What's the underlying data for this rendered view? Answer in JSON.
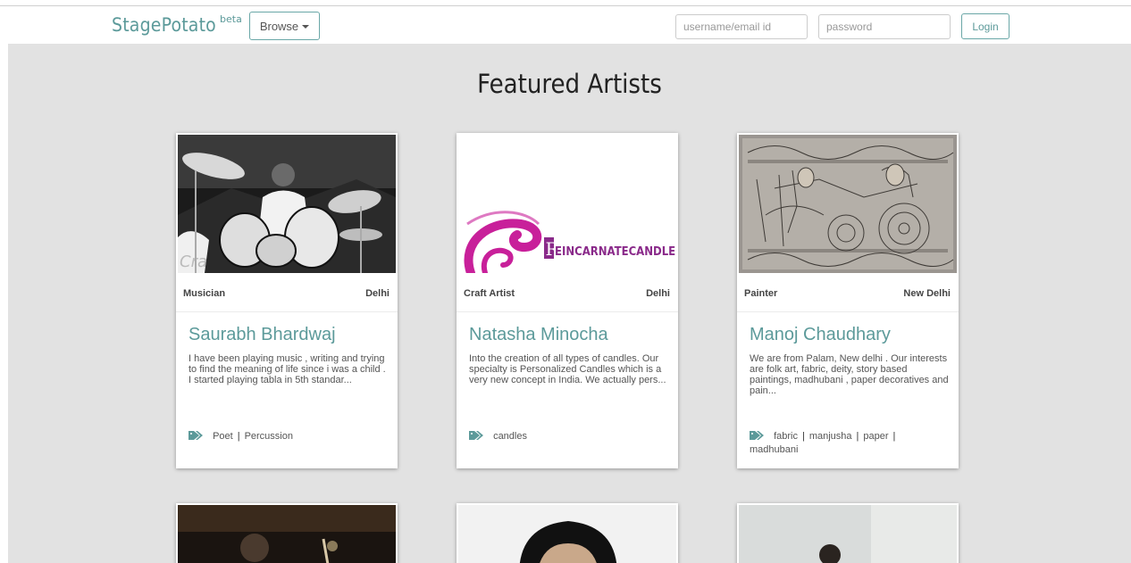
{
  "navbar": {
    "brand": "StagePotato",
    "beta": "beta",
    "browse_label": "Browse",
    "username_placeholder": "username/email id",
    "password_placeholder": "password",
    "login_label": "Login"
  },
  "page": {
    "title": "Featured Artists"
  },
  "cards": [
    {
      "category": "Musician",
      "city": "Delhi",
      "name": "Saurabh Bhardwaj",
      "description": "I have been playing music , writing and trying to find the meaning of life since i was a child . I started playing tabla in 5th standar...",
      "tags": [
        "Poet",
        "Percussion"
      ],
      "image": "drummer-photo"
    },
    {
      "category": "Craft Artist",
      "city": "Delhi",
      "name": "Natasha Minocha",
      "description": "Into the creation of all types of candles. Our specialty is Personalized Candles which is a very new concept in India. We actually pers...",
      "tags": [
        "candles"
      ],
      "image": "reincarnate-candles-logo",
      "logo_text": "EINCARNATECANDLES",
      "logo_initial": "R"
    },
    {
      "category": "Painter",
      "city": "New Delhi",
      "name": "Manoj Chaudhary",
      "description": "We are from Palam, New delhi . Our interests are folk art, fabric, deity, story based paintings, madhubani , paper decoratives and pain...",
      "tags": [
        "fabric",
        "manjusha",
        "paper",
        "madhubani"
      ],
      "image": "folk-art-painting"
    }
  ],
  "colors": {
    "brand": "#5c9a9a",
    "magenta": "#c8209a",
    "purple": "#8a2a8a"
  }
}
